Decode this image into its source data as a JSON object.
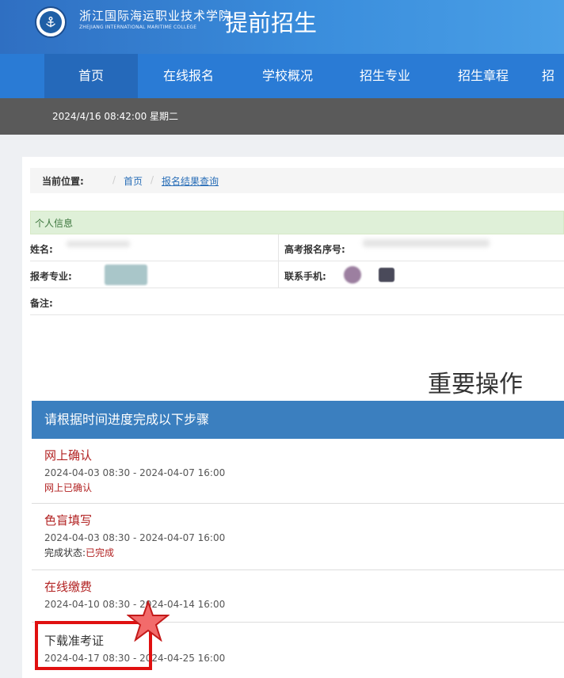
{
  "header": {
    "school_name_cn": "浙江国际海运职业技术学院",
    "school_name_en": "ZHEJIANG INTERNATIONAL MARITIME COLLEGE",
    "site_title": "提前招生",
    "brand_color": "#2a7bd5"
  },
  "nav": {
    "items": [
      {
        "label": "首页"
      },
      {
        "label": "在线报名"
      },
      {
        "label": "学校概况"
      },
      {
        "label": "招生专业"
      },
      {
        "label": "招生章程"
      },
      {
        "label": "招"
      }
    ]
  },
  "datebar": {
    "datetime": "2024/4/16 08:42:00 星期二"
  },
  "breadcrumb": {
    "label": "当前位置:",
    "sep": "/",
    "home": "首页",
    "current": "报名结果查询"
  },
  "personal_info": {
    "title": "个人信息",
    "name_label": "姓名:",
    "exam_no_label": "高考报名序号:",
    "major_label": "报考专业:",
    "phone_label": "联系手机:",
    "remark_label": "备注:"
  },
  "important_heading": "重要操作",
  "steps": {
    "header": "请根据时间进度完成以下步骤",
    "items": [
      {
        "title": "网上确认",
        "time": "2024-04-03 08:30 - 2024-04-07 16:00",
        "status": "网上已确认"
      },
      {
        "title": "色盲填写",
        "time": "2024-04-03 08:30 - 2024-04-07 16:00",
        "status_label": "完成状态:",
        "status": "已完成"
      },
      {
        "title": "在线缴费",
        "time": "2024-04-10 08:30 - 2024-04-14 16:00"
      },
      {
        "title": "下载准考证",
        "time": "2024-04-17 08:30 - 2024-04-25 16:00"
      }
    ]
  },
  "annotation_colors": {
    "highlight": "#e01010",
    "star_fill": "#f26b6b"
  }
}
